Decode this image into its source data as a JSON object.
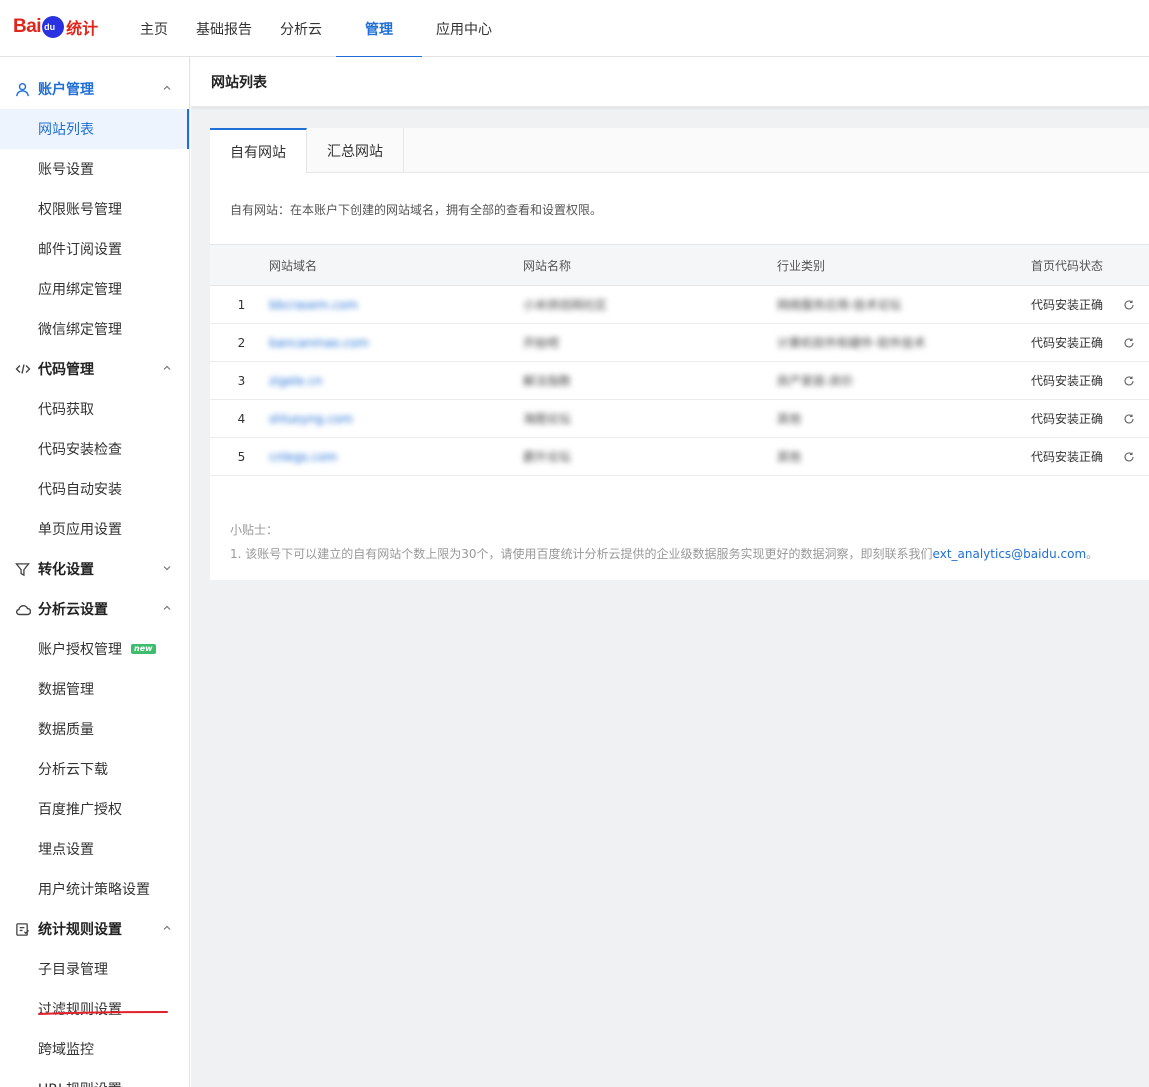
{
  "brand": {
    "bai": "Bai",
    "du": "du",
    "tongji": "统计"
  },
  "nav": [
    {
      "label": "主页"
    },
    {
      "label": "基础报告"
    },
    {
      "label": "分析云"
    },
    {
      "label": "管理"
    },
    {
      "label": "应用中心"
    }
  ],
  "sidebar": {
    "groups": [
      {
        "title": "账户管理",
        "icon": "user-icon",
        "expanded": true,
        "items": [
          "网站列表",
          "账号设置",
          "权限账号管理",
          "邮件订阅设置",
          "应用绑定管理",
          "微信绑定管理"
        ]
      },
      {
        "title": "代码管理",
        "icon": "code-icon",
        "expanded": true,
        "items": [
          "代码获取",
          "代码安装检查",
          "代码自动安装",
          "单页应用设置"
        ]
      },
      {
        "title": "转化设置",
        "icon": "filter-icon",
        "expanded": false,
        "items": []
      },
      {
        "title": "分析云设置",
        "icon": "cloud-icon",
        "expanded": true,
        "items": [
          "账户授权管理",
          "数据管理",
          "数据质量",
          "分析云下载",
          "百度推广授权",
          "埋点设置",
          "用户统计策略设置"
        ]
      },
      {
        "title": "统计规则设置",
        "icon": "rules-icon",
        "expanded": true,
        "items": [
          "子目录管理",
          "过滤规则设置",
          "跨域监控",
          "URL规则设置"
        ]
      }
    ],
    "new_badge": "new",
    "active_item": "网站列表",
    "accent_color": "#1f6fd6",
    "underline_color": "#e0202a"
  },
  "page": {
    "title": "网站列表",
    "tabs": [
      {
        "label": "自有网站"
      },
      {
        "label": "汇总网站"
      }
    ],
    "description": "自有网站：在本账户下创建的网站域名，拥有全部的查看和设置权限。",
    "table": {
      "headers": [
        "网站域名",
        "网站名称",
        "行业类别",
        "首页代码状态"
      ],
      "rows": [
        {
          "idx": "1",
          "domain": "bbcrasem.com",
          "name": "小米烘焙网社区",
          "industry": "网络服务应用-技术论坛",
          "status": "代码安装正确"
        },
        {
          "idx": "2",
          "domain": "bancanmao.com",
          "name": "开始吧",
          "industry": "计算机软件和硬件-软件技术",
          "status": "代码安装正确"
        },
        {
          "idx": "3",
          "domain": "zigele.cn",
          "name": "解法指数",
          "industry": "房产家居-房价",
          "status": "代码安装正确"
        },
        {
          "idx": "4",
          "domain": "shluoyng.com",
          "name": "海图论坛",
          "industry": "其他",
          "status": "代码安装正确"
        },
        {
          "idx": "5",
          "domain": "cnlegs.com",
          "name": "爵升论坛",
          "industry": "其他",
          "status": "代码安装正确"
        }
      ]
    },
    "tips_title": "小贴士：",
    "tips_text": "1. 该账号下可以建立的自有网站个数上限为30个，请使用百度统计分析云提供的企业级数据服务实现更好的数据洞察，即刻联系我们",
    "tips_email": "ext_analytics@baidu.com",
    "tips_end": "。"
  }
}
